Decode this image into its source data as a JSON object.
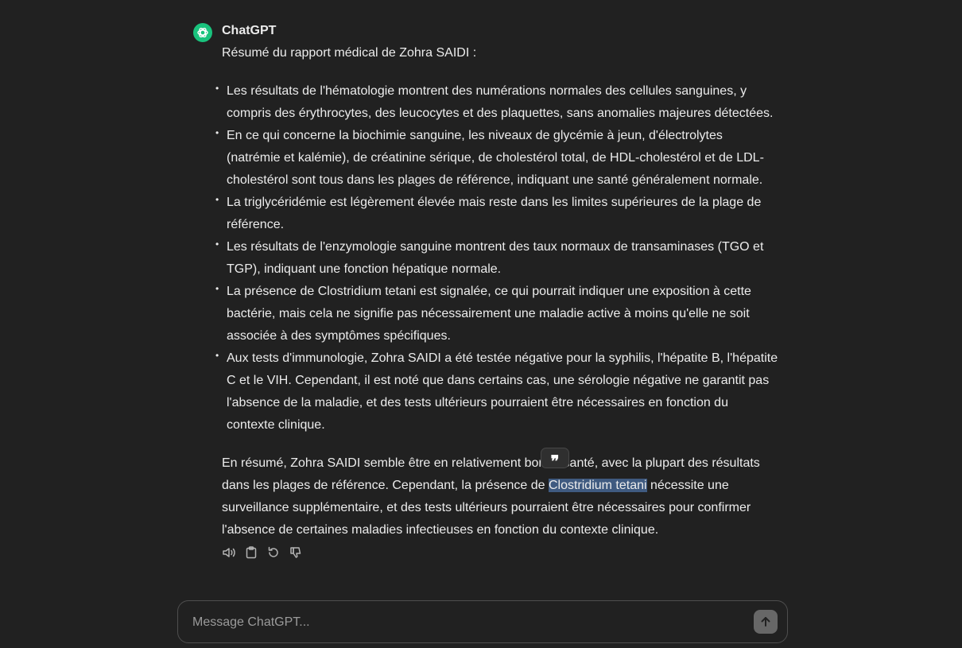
{
  "message": {
    "sender": "ChatGPT",
    "intro": "Résumé du rapport médical de Zohra SAIDI :",
    "points": [
      "Les résultats de l'hématologie montrent des numérations normales des cellules sanguines, y compris des érythrocytes, des leucocytes et des plaquettes, sans anomalies majeures détectées.",
      "En ce qui concerne la biochimie sanguine, les niveaux de glycémie à jeun, d'électrolytes (natrémie et kalémie), de créatinine sérique, de cholestérol total, de HDL-cholestérol et de LDL-cholestérol sont tous dans les plages de référence, indiquant une santé généralement normale.",
      "La triglycéridémie est légèrement élevée mais reste dans les limites supérieures de la plage de référence.",
      "Les résultats de l'enzymologie sanguine montrent des taux normaux de transaminases (TGO et TGP), indiquant une fonction hépatique normale.",
      "La présence de Clostridium tetani est signalée, ce qui pourrait indiquer une exposition à cette bactérie, mais cela ne signifie pas nécessairement une maladie active à moins qu'elle ne soit associée à des symptômes spécifiques.",
      "Aux tests d'immunologie, Zohra SAIDI a été testée négative pour la syphilis, l'hépatite B, l'hépatite C et le VIH. Cependant, il est noté que dans certains cas, une sérologie négative ne garantit pas l'absence de la maladie, et des tests ultérieurs pourraient être nécessaires en fonction du contexte clinique."
    ],
    "summary_before": "En résumé, Zohra SAIDI semble être en relativement bonne santé, avec la plupart des résultats dans les plages de référence. Cependant, la présence de ",
    "summary_highlight": "Clostridium tetani",
    "summary_after": " nécessite une surveillance supplémentaire, et des tests ultérieurs pourraient être nécessaires pour confirmer l'absence de certaines maladies infectieuses en fonction du contexte clinique."
  },
  "quote_button": {
    "label": "❞"
  },
  "actions": [
    "speaker-icon",
    "clipboard-icon",
    "regenerate-icon",
    "thumbs-down-icon"
  ],
  "composer": {
    "placeholder": "Message ChatGPT..."
  },
  "colors": {
    "background": "#212121",
    "text": "#ececec",
    "avatar": "#19c37d",
    "highlight": "#3f5a80"
  }
}
